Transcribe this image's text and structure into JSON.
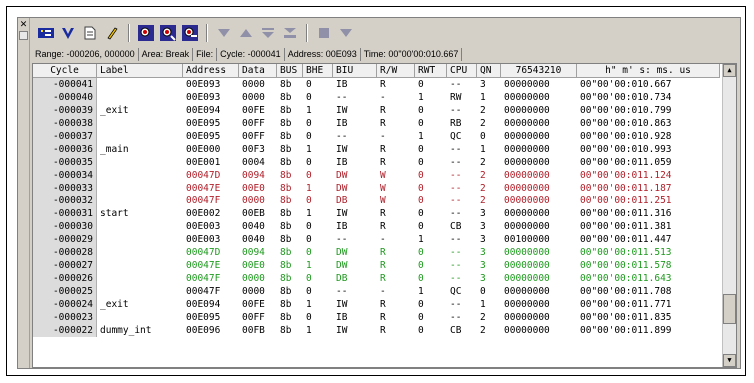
{
  "info": {
    "range": "Range: -000206,  000000",
    "area": "Area: Break",
    "file": "File:",
    "cycle": "Cycle: -000041",
    "address": "Address: 00E093",
    "time": "Time: 00\"00'00:010.667"
  },
  "columns": [
    "Cycle",
    "Label",
    "Address",
    "Data",
    "BUS",
    "BHE",
    "BIU",
    "R/W",
    "RWT",
    "CPU",
    "QN",
    "76543210",
    "h\" m' s: ms. us"
  ],
  "colors": {
    "red": "#b0202a",
    "green": "#1e9a1e",
    "normal": "#000000"
  },
  "rows": [
    {
      "cyc": "-000041",
      "label": "",
      "addr": "00E093",
      "data": "0000",
      "bus": "8b",
      "bhe": "0",
      "biu": "IB",
      "rw": "R",
      "rwt": "0",
      "cpu": "--",
      "qn": "3",
      "bits": "00000000",
      "time": "00\"00'00:010.667",
      "color": "normal"
    },
    {
      "cyc": "-000040",
      "label": "",
      "addr": "00E093",
      "data": "0000",
      "bus": "8b",
      "bhe": "0",
      "biu": "--",
      "rw": "-",
      "rwt": "1",
      "cpu": "RW",
      "qn": "1",
      "bits": "00000000",
      "time": "00\"00'00:010.734",
      "color": "normal"
    },
    {
      "cyc": "-000039",
      "label": "_exit",
      "addr": "00E094",
      "data": "00FE",
      "bus": "8b",
      "bhe": "1",
      "biu": "IW",
      "rw": "R",
      "rwt": "0",
      "cpu": "--",
      "qn": "2",
      "bits": "00000000",
      "time": "00\"00'00:010.799",
      "color": "normal"
    },
    {
      "cyc": "-000038",
      "label": "",
      "addr": "00E095",
      "data": "00FF",
      "bus": "8b",
      "bhe": "0",
      "biu": "IB",
      "rw": "R",
      "rwt": "0",
      "cpu": "RB",
      "qn": "2",
      "bits": "00000000",
      "time": "00\"00'00:010.863",
      "color": "normal"
    },
    {
      "cyc": "-000037",
      "label": "",
      "addr": "00E095",
      "data": "00FF",
      "bus": "8b",
      "bhe": "0",
      "biu": "--",
      "rw": "-",
      "rwt": "1",
      "cpu": "QC",
      "qn": "0",
      "bits": "00000000",
      "time": "00\"00'00:010.928",
      "color": "normal"
    },
    {
      "cyc": "-000036",
      "label": "_main",
      "addr": "00E000",
      "data": "00F3",
      "bus": "8b",
      "bhe": "1",
      "biu": "IW",
      "rw": "R",
      "rwt": "0",
      "cpu": "--",
      "qn": "1",
      "bits": "00000000",
      "time": "00\"00'00:010.993",
      "color": "normal"
    },
    {
      "cyc": "-000035",
      "label": "",
      "addr": "00E001",
      "data": "0004",
      "bus": "8b",
      "bhe": "0",
      "biu": "IB",
      "rw": "R",
      "rwt": "0",
      "cpu": "--",
      "qn": "2",
      "bits": "00000000",
      "time": "00\"00'00:011.059",
      "color": "normal"
    },
    {
      "cyc": "-000034",
      "label": "",
      "addr": "00047D",
      "data": "0094",
      "bus": "8b",
      "bhe": "0",
      "biu": "DW",
      "rw": "W",
      "rwt": "0",
      "cpu": "--",
      "qn": "2",
      "bits": "00000000",
      "time": "00\"00'00:011.124",
      "color": "red"
    },
    {
      "cyc": "-000033",
      "label": "",
      "addr": "00047E",
      "data": "00E0",
      "bus": "8b",
      "bhe": "1",
      "biu": "DW",
      "rw": "W",
      "rwt": "0",
      "cpu": "--",
      "qn": "2",
      "bits": "00000000",
      "time": "00\"00'00:011.187",
      "color": "red"
    },
    {
      "cyc": "-000032",
      "label": "",
      "addr": "00047F",
      "data": "0000",
      "bus": "8b",
      "bhe": "0",
      "biu": "DB",
      "rw": "W",
      "rwt": "0",
      "cpu": "--",
      "qn": "2",
      "bits": "00000000",
      "time": "00\"00'00:011.251",
      "color": "red"
    },
    {
      "cyc": "-000031",
      "label": "start",
      "addr": "00E002",
      "data": "00EB",
      "bus": "8b",
      "bhe": "1",
      "biu": "IW",
      "rw": "R",
      "rwt": "0",
      "cpu": "--",
      "qn": "3",
      "bits": "00000000",
      "time": "00\"00'00:011.316",
      "color": "normal"
    },
    {
      "cyc": "-000030",
      "label": "",
      "addr": "00E003",
      "data": "0040",
      "bus": "8b",
      "bhe": "0",
      "biu": "IB",
      "rw": "R",
      "rwt": "0",
      "cpu": "CB",
      "qn": "3",
      "bits": "00000000",
      "time": "00\"00'00:011.381",
      "color": "normal"
    },
    {
      "cyc": "-000029",
      "label": "",
      "addr": "00E003",
      "data": "0040",
      "bus": "8b",
      "bhe": "0",
      "biu": "--",
      "rw": "-",
      "rwt": "1",
      "cpu": "--",
      "qn": "3",
      "bits": "00100000",
      "time": "00\"00'00:011.447",
      "color": "normal"
    },
    {
      "cyc": "-000028",
      "label": "",
      "addr": "00047D",
      "data": "0094",
      "bus": "8b",
      "bhe": "0",
      "biu": "DW",
      "rw": "R",
      "rwt": "0",
      "cpu": "--",
      "qn": "3",
      "bits": "00000000",
      "time": "00\"00'00:011.513",
      "color": "green"
    },
    {
      "cyc": "-000027",
      "label": "",
      "addr": "00047E",
      "data": "00E0",
      "bus": "8b",
      "bhe": "1",
      "biu": "DW",
      "rw": "R",
      "rwt": "0",
      "cpu": "--",
      "qn": "3",
      "bits": "00000000",
      "time": "00\"00'00:011.578",
      "color": "green"
    },
    {
      "cyc": "-000026",
      "label": "",
      "addr": "00047F",
      "data": "0000",
      "bus": "8b",
      "bhe": "0",
      "biu": "DB",
      "rw": "R",
      "rwt": "0",
      "cpu": "--",
      "qn": "3",
      "bits": "00000000",
      "time": "00\"00'00:011.643",
      "color": "green"
    },
    {
      "cyc": "-000025",
      "label": "",
      "addr": "00047F",
      "data": "0000",
      "bus": "8b",
      "bhe": "0",
      "biu": "--",
      "rw": "-",
      "rwt": "1",
      "cpu": "QC",
      "qn": "0",
      "bits": "00000000",
      "time": "00\"00'00:011.708",
      "color": "normal"
    },
    {
      "cyc": "-000024",
      "label": "_exit",
      "addr": "00E094",
      "data": "00FE",
      "bus": "8b",
      "bhe": "1",
      "biu": "IW",
      "rw": "R",
      "rwt": "0",
      "cpu": "--",
      "qn": "1",
      "bits": "00000000",
      "time": "00\"00'00:011.771",
      "color": "normal"
    },
    {
      "cyc": "-000023",
      "label": "",
      "addr": "00E095",
      "data": "00FF",
      "bus": "8b",
      "bhe": "0",
      "biu": "IB",
      "rw": "R",
      "rwt": "0",
      "cpu": "--",
      "qn": "2",
      "bits": "00000000",
      "time": "00\"00'00:011.835",
      "color": "normal"
    },
    {
      "cyc": "-000022",
      "label": "dummy_int",
      "addr": "00E096",
      "data": "00FB",
      "bus": "8b",
      "bhe": "1",
      "biu": "IW",
      "rw": "R",
      "rwt": "0",
      "cpu": "CB",
      "qn": "2",
      "bits": "00000000",
      "time": "00\"00'00:011.899",
      "color": "normal"
    }
  ]
}
